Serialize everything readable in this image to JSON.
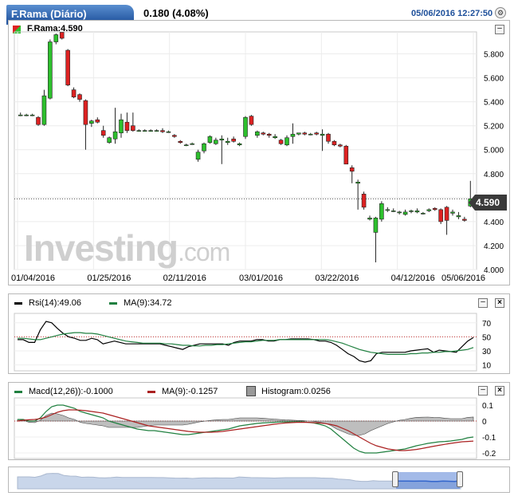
{
  "header": {
    "title": "F.Rama (Diário)",
    "change": "0.180 (4.08%)",
    "datetime": "05/06/2016 12:27:50",
    "gear_icon": "gear-icon"
  },
  "main_panel": {
    "legend": "F.Rama:4.590",
    "last_price_label": "4.590"
  },
  "watermark": {
    "brand": "Investing",
    "suffix": ".com"
  },
  "rsi_panel": {
    "label1": "Rsi(14):49.06",
    "label2": "MA(9):34.72"
  },
  "macd_panel": {
    "label1": "Macd(12,26)):-0.1000",
    "label2": "MA(9):-0.1257",
    "label3": "Histogram:0.0256"
  },
  "colors": {
    "up": "#2dc02d",
    "down": "#dd2222",
    "rsi": "#000000",
    "rsi_ma": "#208040",
    "macd": "#208040",
    "macd_signal": "#aa2020",
    "histogram": "#888888",
    "navigator": "#3366cc"
  },
  "chart_data": [
    {
      "type": "candlestick",
      "title": "F.Rama (Diário)",
      "x_ticks": [
        "01/04/2016",
        "01/25/2016",
        "02/11/2016",
        "03/01/2016",
        "03/22/2016",
        "04/12/2016",
        "05/06/2016"
      ],
      "y_ticks": [
        "5.800",
        "5.600",
        "5.400",
        "5.200",
        "5.000",
        "4.800",
        "4.600",
        "4.400",
        "4.200",
        "4.000"
      ],
      "ylim": [
        4.0,
        5.95
      ],
      "last_price": 4.59,
      "candles": [
        [
          5.29,
          5.31,
          5.28,
          5.29
        ],
        [
          5.29,
          5.3,
          5.28,
          5.29
        ],
        [
          5.29,
          5.3,
          5.28,
          5.29
        ],
        [
          5.27,
          5.28,
          5.2,
          5.21
        ],
        [
          5.21,
          5.5,
          5.2,
          5.45
        ],
        [
          5.43,
          5.92,
          5.42,
          5.9
        ],
        [
          5.9,
          5.97,
          5.88,
          5.96
        ],
        [
          5.98,
          5.98,
          5.92,
          5.93
        ],
        [
          5.83,
          5.84,
          5.53,
          5.54
        ],
        [
          5.5,
          5.52,
          5.43,
          5.44
        ],
        [
          5.46,
          5.47,
          5.4,
          5.42
        ],
        [
          5.41,
          5.42,
          5.0,
          5.21
        ],
        [
          5.22,
          5.25,
          5.19,
          5.24
        ],
        [
          5.25,
          5.27,
          5.22,
          5.23
        ],
        [
          5.16,
          5.2,
          5.1,
          5.12
        ],
        [
          5.06,
          5.11,
          5.05,
          5.1
        ],
        [
          5.09,
          5.35,
          5.05,
          5.15
        ],
        [
          5.14,
          5.3,
          5.1,
          5.25
        ],
        [
          5.23,
          5.31,
          5.14,
          5.16
        ],
        [
          5.2,
          5.31,
          5.15,
          5.16
        ],
        [
          5.16,
          5.17,
          5.15,
          5.16
        ],
        [
          5.16,
          5.17,
          5.15,
          5.16
        ],
        [
          5.16,
          5.17,
          5.15,
          5.16
        ],
        [
          5.16,
          5.17,
          5.15,
          5.16
        ],
        [
          5.16,
          5.18,
          5.14,
          5.15
        ],
        [
          5.15,
          5.16,
          5.14,
          5.15
        ],
        [
          5.12,
          5.13,
          5.1,
          5.11
        ],
        [
          5.07,
          5.08,
          5.05,
          5.06
        ],
        [
          5.04,
          5.05,
          5.03,
          5.04
        ],
        [
          5.05,
          5.06,
          5.04,
          5.05
        ],
        [
          4.92,
          5.0,
          4.9,
          4.98
        ],
        [
          4.99,
          5.06,
          4.97,
          5.05
        ],
        [
          5.06,
          5.12,
          5.05,
          5.11
        ],
        [
          5.05,
          5.1,
          5.04,
          5.08
        ],
        [
          5.08,
          5.12,
          4.88,
          5.09
        ],
        [
          5.06,
          5.1,
          5.04,
          5.07
        ],
        [
          5.09,
          5.11,
          5.06,
          5.07
        ],
        [
          5.04,
          5.06,
          5.03,
          5.05
        ],
        [
          5.11,
          5.28,
          5.09,
          5.27
        ],
        [
          5.28,
          5.29,
          5.2,
          5.21
        ],
        [
          5.12,
          5.16,
          5.1,
          5.15
        ],
        [
          5.14,
          5.15,
          5.12,
          5.13
        ],
        [
          5.13,
          5.14,
          5.1,
          5.12
        ],
        [
          5.1,
          5.13,
          5.09,
          5.11
        ],
        [
          5.08,
          5.09,
          5.04,
          5.05
        ],
        [
          5.04,
          5.12,
          5.03,
          5.1
        ],
        [
          5.11,
          5.22,
          5.05,
          5.13
        ],
        [
          5.13,
          5.14,
          5.12,
          5.14
        ],
        [
          5.14,
          5.15,
          5.12,
          5.13
        ],
        [
          5.13,
          5.14,
          5.12,
          5.13
        ],
        [
          5.14,
          5.15,
          5.12,
          5.13
        ],
        [
          5.12,
          5.17,
          4.99,
          5.13
        ],
        [
          5.13,
          5.14,
          5.05,
          5.07
        ],
        [
          5.07,
          5.08,
          5.03,
          5.04
        ],
        [
          5.04,
          5.05,
          5.02,
          5.03
        ],
        [
          5.03,
          5.04,
          4.88,
          4.88
        ],
        [
          4.85,
          4.87,
          4.72,
          4.82
        ],
        [
          4.72,
          4.75,
          4.5,
          4.73
        ],
        [
          4.63,
          4.65,
          4.5,
          4.52
        ],
        [
          4.42,
          4.45,
          4.41,
          4.43
        ],
        [
          4.31,
          4.44,
          4.06,
          4.43
        ],
        [
          4.42,
          4.57,
          4.4,
          4.55
        ],
        [
          4.5,
          4.52,
          4.48,
          4.5
        ],
        [
          4.49,
          4.51,
          4.48,
          4.49
        ],
        [
          4.48,
          4.49,
          4.46,
          4.48
        ],
        [
          4.46,
          4.5,
          4.45,
          4.48
        ],
        [
          4.49,
          4.5,
          4.47,
          4.49
        ],
        [
          4.48,
          4.51,
          4.47,
          4.49
        ],
        [
          4.47,
          4.48,
          4.46,
          4.47
        ],
        [
          4.49,
          4.51,
          4.48,
          4.5
        ],
        [
          4.51,
          4.52,
          4.49,
          4.5
        ],
        [
          4.5,
          4.51,
          4.38,
          4.4
        ],
        [
          4.52,
          4.53,
          4.29,
          4.41
        ],
        [
          4.47,
          4.5,
          4.45,
          4.48
        ],
        [
          4.44,
          4.48,
          4.42,
          4.45
        ],
        [
          4.42,
          4.44,
          4.4,
          4.41
        ],
        [
          4.53,
          4.74,
          4.52,
          4.59
        ]
      ]
    },
    {
      "type": "line",
      "title": "Rsi(14)",
      "y_ticks": [
        "70",
        "50",
        "30",
        "10"
      ],
      "ylim": [
        5,
        80
      ],
      "reference_line": 50,
      "series": [
        {
          "name": "Rsi(14)",
          "values": [
            46,
            46,
            42,
            42,
            60,
            72,
            70,
            62,
            55,
            50,
            48,
            45,
            45,
            48,
            46,
            40,
            42,
            44,
            42,
            40,
            40,
            40,
            40,
            40,
            40,
            40,
            38,
            36,
            34,
            32,
            36,
            38,
            40,
            40,
            40,
            40,
            40,
            38,
            42,
            44,
            44,
            44,
            46,
            46,
            44,
            44,
            46,
            46,
            47,
            47,
            47,
            47,
            46,
            44,
            44,
            42,
            38,
            32,
            26,
            22,
            16,
            14,
            16,
            26,
            28,
            28,
            28,
            28,
            28,
            30,
            31,
            32,
            33,
            28,
            31,
            30,
            29,
            28,
            36,
            44,
            49.06
          ]
        },
        {
          "name": "MA(9)",
          "values": [
            48,
            48,
            47,
            46,
            46,
            48,
            50,
            52,
            54,
            55,
            56,
            56,
            55,
            55,
            54,
            52,
            50,
            48,
            46,
            44,
            43,
            42,
            41,
            41,
            41,
            41,
            40,
            40,
            39,
            38,
            38,
            37,
            37,
            38,
            38,
            39,
            39,
            40,
            41,
            42,
            43,
            43,
            44,
            45,
            45,
            45,
            46,
            46,
            46,
            46,
            46,
            46,
            46,
            46,
            46,
            45,
            43,
            41,
            38,
            35,
            32,
            30,
            28,
            27,
            26,
            25,
            25,
            25,
            25,
            26,
            26,
            27,
            27,
            28,
            28,
            29,
            29,
            30,
            31,
            32,
            34.72
          ]
        }
      ]
    },
    {
      "type": "line",
      "title": "Macd(12,26)",
      "y_ticks": [
        "0.1",
        "0",
        "-0.1",
        "-0.2"
      ],
      "ylim": [
        -0.22,
        0.13
      ],
      "reference_line": 0,
      "series": [
        {
          "name": "Macd(12,26)",
          "values": [
            0.01,
            0.01,
            0.0,
            0.0,
            0.02,
            0.06,
            0.09,
            0.1,
            0.1,
            0.09,
            0.08,
            0.06,
            0.05,
            0.04,
            0.03,
            0.02,
            0.0,
            -0.01,
            -0.02,
            -0.03,
            -0.04,
            -0.05,
            -0.055,
            -0.06,
            -0.06,
            -0.065,
            -0.07,
            -0.075,
            -0.08,
            -0.085,
            -0.085,
            -0.08,
            -0.075,
            -0.07,
            -0.065,
            -0.06,
            -0.055,
            -0.05,
            -0.04,
            -0.03,
            -0.025,
            -0.02,
            -0.015,
            -0.012,
            -0.01,
            -0.008,
            -0.006,
            -0.005,
            -0.004,
            -0.004,
            -0.005,
            -0.008,
            -0.012,
            -0.02,
            -0.03,
            -0.05,
            -0.08,
            -0.11,
            -0.14,
            -0.17,
            -0.19,
            -0.2,
            -0.2,
            -0.2,
            -0.195,
            -0.19,
            -0.185,
            -0.18,
            -0.175,
            -0.165,
            -0.155,
            -0.148,
            -0.14,
            -0.135,
            -0.13,
            -0.128,
            -0.125,
            -0.12,
            -0.115,
            -0.105,
            -0.1
          ]
        },
        {
          "name": "MA(9)",
          "values": [
            0.0,
            0.005,
            0.008,
            0.01,
            0.015,
            0.025,
            0.04,
            0.055,
            0.065,
            0.07,
            0.07,
            0.068,
            0.065,
            0.06,
            0.055,
            0.05,
            0.04,
            0.03,
            0.02,
            0.01,
            0.0,
            -0.01,
            -0.02,
            -0.03,
            -0.035,
            -0.04,
            -0.045,
            -0.05,
            -0.055,
            -0.06,
            -0.065,
            -0.068,
            -0.07,
            -0.07,
            -0.07,
            -0.068,
            -0.065,
            -0.06,
            -0.055,
            -0.05,
            -0.045,
            -0.04,
            -0.035,
            -0.03,
            -0.025,
            -0.02,
            -0.016,
            -0.012,
            -0.01,
            -0.008,
            -0.008,
            -0.008,
            -0.01,
            -0.012,
            -0.016,
            -0.022,
            -0.03,
            -0.045,
            -0.06,
            -0.08,
            -0.1,
            -0.12,
            -0.14,
            -0.155,
            -0.165,
            -0.175,
            -0.18,
            -0.185,
            -0.185,
            -0.182,
            -0.178,
            -0.172,
            -0.165,
            -0.158,
            -0.152,
            -0.146,
            -0.14,
            -0.135,
            -0.13,
            -0.128,
            -0.1257
          ]
        }
      ],
      "histogram_label": "Histogram:0.0256"
    }
  ]
}
